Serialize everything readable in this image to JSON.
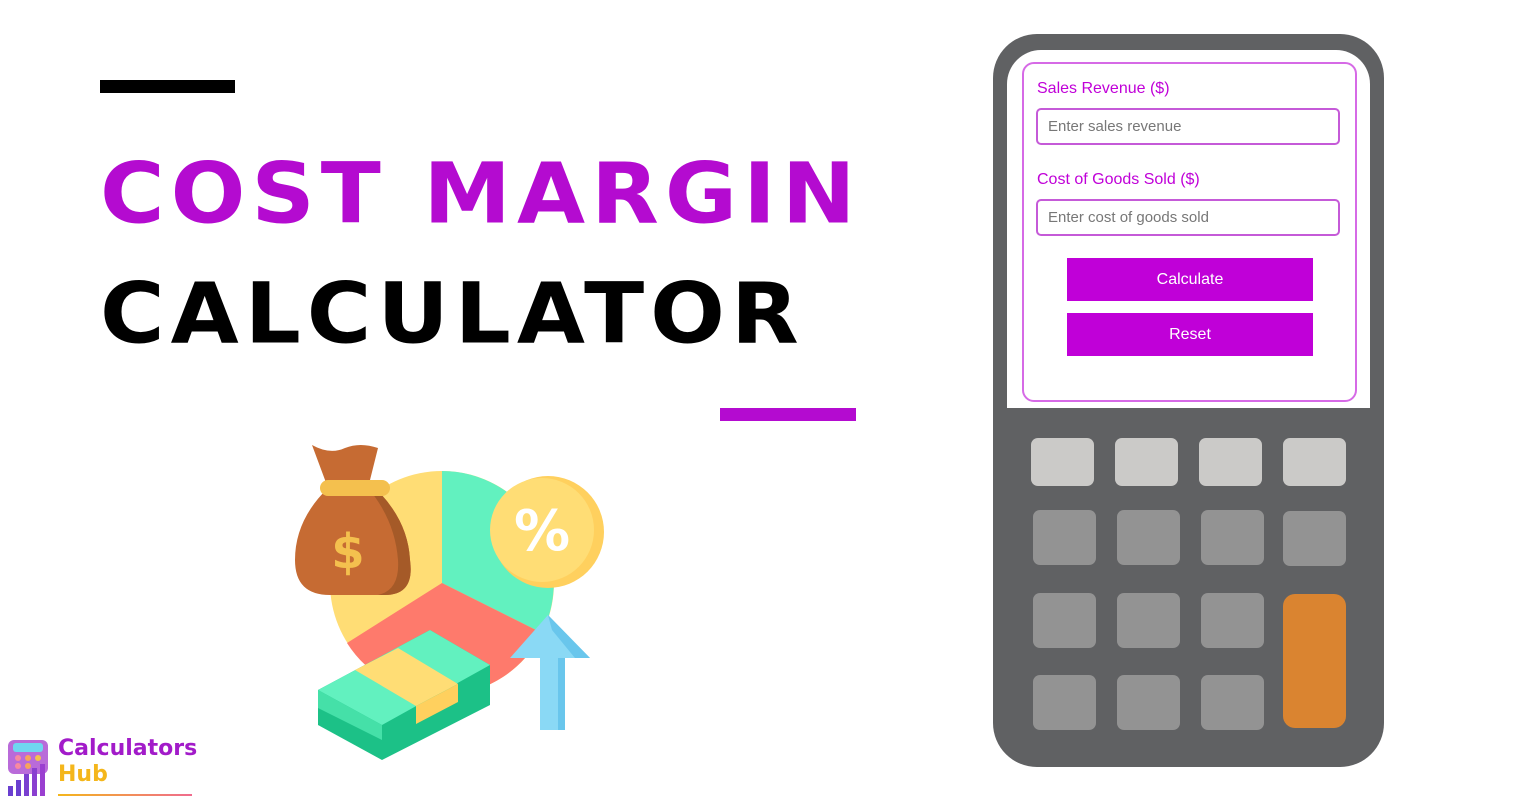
{
  "title": {
    "line1": "COST MARGIN",
    "line2": "CALCULATOR"
  },
  "colors": {
    "accent": "#b40bd0",
    "button": "#c000d8",
    "calculator_body": "#606163",
    "key_light": "#cbcac8",
    "key_mid": "#939393",
    "key_accent": "#da8430"
  },
  "calculator": {
    "fields": [
      {
        "label": "Sales Revenue ($)",
        "placeholder": "Enter sales revenue",
        "value": ""
      },
      {
        "label": "Cost of Goods Sold ($)",
        "placeholder": "Enter cost of goods sold",
        "value": ""
      }
    ],
    "buttons": {
      "calculate": "Calculate",
      "reset": "Reset"
    }
  },
  "illustration": {
    "icons": [
      "money-bag-icon",
      "dollar-sign-icon",
      "pie-chart-icon",
      "percent-coin-icon",
      "cash-stack-icon",
      "up-arrow-icon"
    ],
    "dollar_symbol": "$",
    "percent_symbol": "%"
  },
  "logo": {
    "line1": "Calculators",
    "line2": "Hub"
  }
}
